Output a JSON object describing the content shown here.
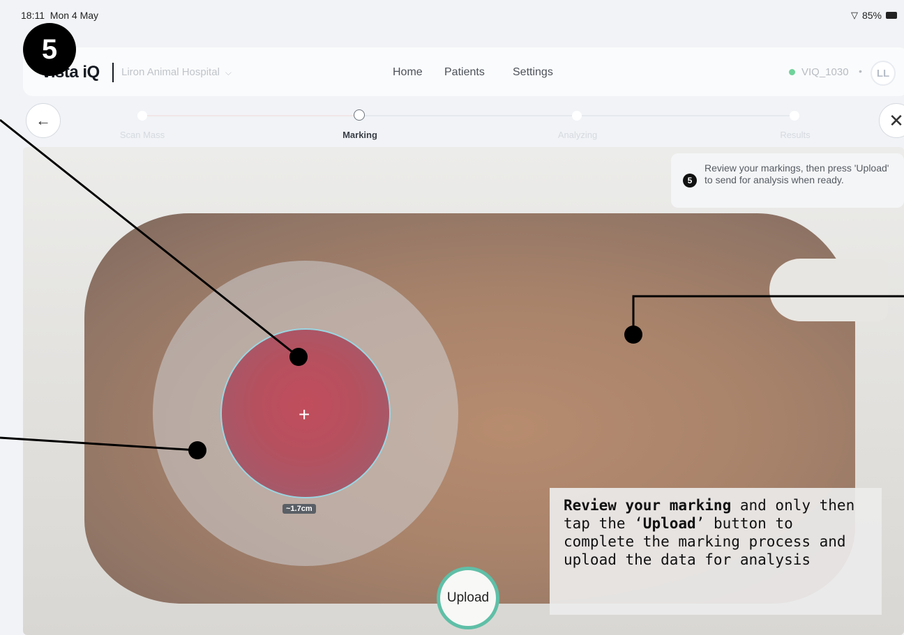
{
  "status": {
    "time": "18:11",
    "date": "Mon 4 May",
    "battery": "85%"
  },
  "step_badge": "5",
  "nav": {
    "logo": "vista iQ",
    "clinic": "Liron Animal Hospital",
    "items": [
      "Home",
      "Patients",
      "Settings"
    ],
    "device_id": "VIQ_1030",
    "avatar": "LL"
  },
  "stepper": {
    "steps": [
      "Scan Mass",
      "Marking",
      "Analyzing",
      "Results"
    ],
    "current": "Marking"
  },
  "tooltip": {
    "number": "5",
    "text": "Review your markings, then press 'Upload' to send for analysis when ready."
  },
  "marking": {
    "size_label": "~1.7cm"
  },
  "instruction": {
    "bold1": "Review your marking",
    "part1": " and only then tap the ‘",
    "bold2": "Upload",
    "part2": "’ button to complete the marking process and upload the data for analysis"
  },
  "upload_button": "Upload",
  "icons": {
    "back": "arrow-left-icon",
    "close": "close-icon",
    "wifi": "wifi-icon",
    "battery": "battery-icon",
    "clinic_dropdown": "chevron-down-icon"
  },
  "colors": {
    "accent_teal": "#5fbfa7",
    "marking_ring": "#9ad6e2",
    "online_dot": "#6fd39a"
  }
}
